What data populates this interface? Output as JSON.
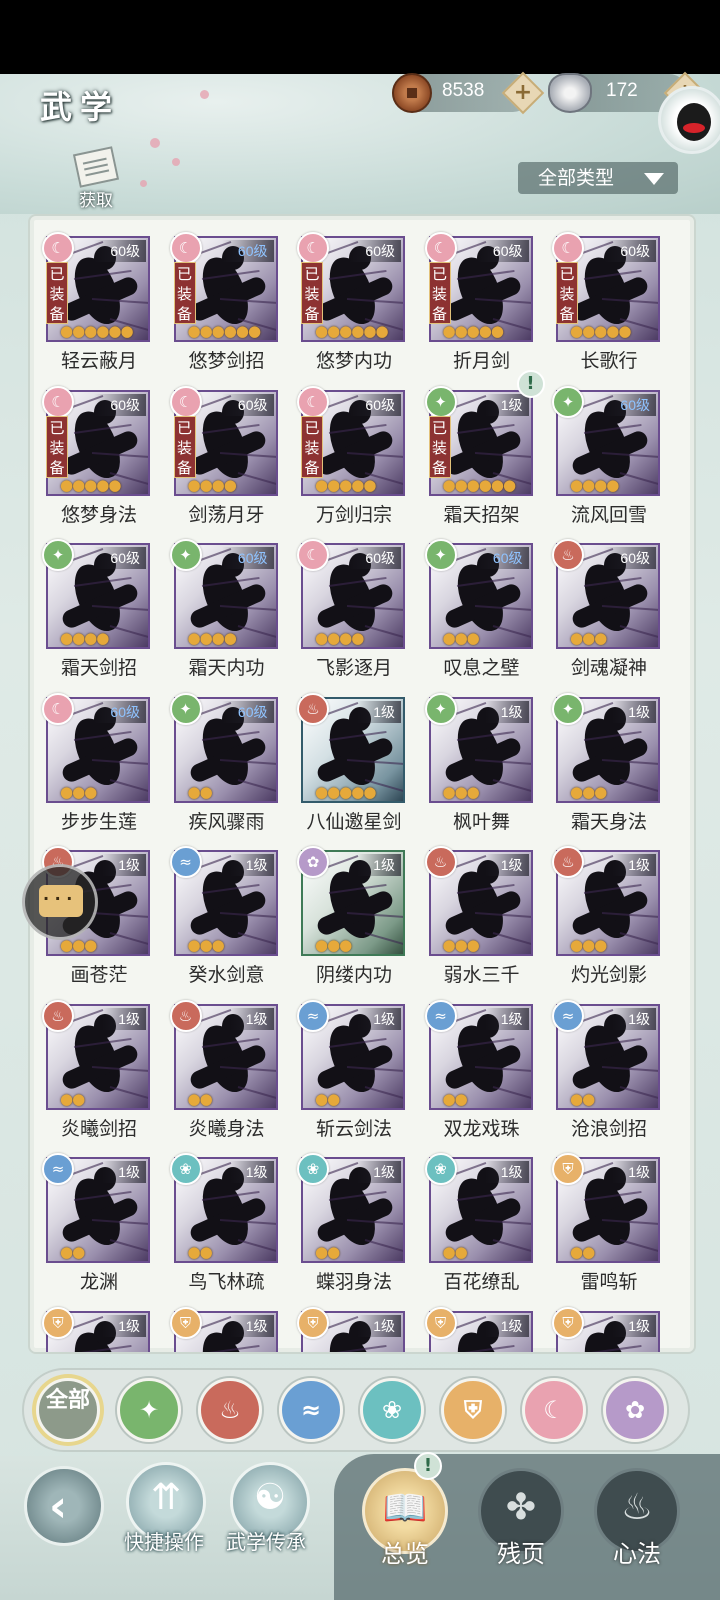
{
  "header": {
    "title": "武学",
    "copper": "8538",
    "silver": "172",
    "acquire_label": "获取",
    "filter_label": "全部类型"
  },
  "skills": [
    {
      "name": "轻云蔽月",
      "level": "60级",
      "element": "pink",
      "equipped": true,
      "stars": 6
    },
    {
      "name": "悠梦剑招",
      "level": "60级",
      "element": "pink",
      "equipped": true,
      "stars": 6,
      "level_blue": true
    },
    {
      "name": "悠梦内功",
      "level": "60级",
      "element": "pink",
      "equipped": true,
      "stars": 6
    },
    {
      "name": "折月剑",
      "level": "60级",
      "element": "pink",
      "equipped": true,
      "stars": 5
    },
    {
      "name": "长歌行",
      "level": "60级",
      "element": "pink",
      "equipped": true,
      "stars": 5
    },
    {
      "name": "悠梦身法",
      "level": "60级",
      "element": "pink",
      "equipped": true,
      "stars": 5
    },
    {
      "name": "剑荡月牙",
      "level": "60级",
      "element": "pink",
      "equipped": true,
      "stars": 4
    },
    {
      "name": "万剑归宗",
      "level": "60级",
      "element": "pink",
      "equipped": true,
      "stars": 5
    },
    {
      "name": "霜天招架",
      "level": "1级",
      "element": "green",
      "equipped": true,
      "stars": 6,
      "alert": true
    },
    {
      "name": "流风回雪",
      "level": "60级",
      "element": "green",
      "equipped": false,
      "stars": 4,
      "level_blue": true
    },
    {
      "name": "霜天剑招",
      "level": "60级",
      "element": "green",
      "equipped": false,
      "stars": 4
    },
    {
      "name": "霜天内功",
      "level": "60级",
      "element": "green",
      "equipped": false,
      "stars": 4,
      "level_blue": true
    },
    {
      "name": "飞影逐月",
      "level": "60级",
      "element": "pink",
      "equipped": false,
      "stars": 4
    },
    {
      "name": "叹息之壁",
      "level": "60级",
      "element": "green",
      "equipped": false,
      "stars": 3,
      "level_blue": true
    },
    {
      "name": "剑魂凝神",
      "level": "60级",
      "element": "red",
      "equipped": false,
      "stars": 3
    },
    {
      "name": "步步生莲",
      "level": "60级",
      "element": "pink",
      "equipped": false,
      "stars": 3,
      "level_blue": true
    },
    {
      "name": "疾风骤雨",
      "level": "60级",
      "element": "green",
      "equipped": false,
      "stars": 2,
      "level_blue": true
    },
    {
      "name": "八仙邀星剑",
      "level": "1级",
      "element": "red",
      "equipped": false,
      "stars": 5,
      "frame": "teal"
    },
    {
      "name": "枫叶舞",
      "level": "1级",
      "element": "green",
      "equipped": false,
      "stars": 3
    },
    {
      "name": "霜天身法",
      "level": "1级",
      "element": "green",
      "equipped": false,
      "stars": 3
    },
    {
      "name": "画苍茫",
      "level": "1级",
      "element": "red",
      "equipped": false,
      "stars": 3
    },
    {
      "name": "癸水剑意",
      "level": "1级",
      "element": "blue",
      "equipped": false,
      "stars": 3
    },
    {
      "name": "阴缕内功",
      "level": "1级",
      "element": "purple",
      "equipped": false,
      "stars": 3,
      "frame": "green"
    },
    {
      "name": "弱水三千",
      "level": "1级",
      "element": "red",
      "equipped": false,
      "stars": 3
    },
    {
      "name": "灼光剑影",
      "level": "1级",
      "element": "red",
      "equipped": false,
      "stars": 3
    },
    {
      "name": "炎曦剑招",
      "level": "1级",
      "element": "red",
      "equipped": false,
      "stars": 2
    },
    {
      "name": "炎曦身法",
      "level": "1级",
      "element": "red",
      "equipped": false,
      "stars": 2
    },
    {
      "name": "斩云剑法",
      "level": "1级",
      "element": "blue",
      "equipped": false,
      "stars": 2
    },
    {
      "name": "双龙戏珠",
      "level": "1级",
      "element": "blue",
      "equipped": false,
      "stars": 2
    },
    {
      "name": "沧浪剑招",
      "level": "1级",
      "element": "blue",
      "equipped": false,
      "stars": 2
    },
    {
      "name": "龙渊",
      "level": "1级",
      "element": "blue",
      "equipped": false,
      "stars": 2
    },
    {
      "name": "鸟飞林疏",
      "level": "1级",
      "element": "cyan",
      "equipped": false,
      "stars": 2
    },
    {
      "name": "蝶羽身法",
      "level": "1级",
      "element": "cyan",
      "equipped": false,
      "stars": 2
    },
    {
      "name": "百花缭乱",
      "level": "1级",
      "element": "cyan",
      "equipped": false,
      "stars": 2
    },
    {
      "name": "雷鸣斩",
      "level": "1级",
      "element": "gold",
      "equipped": false,
      "stars": 2
    },
    {
      "name": "",
      "level": "1级",
      "element": "gold",
      "equipped": false,
      "stars": 0
    },
    {
      "name": "",
      "level": "1级",
      "element": "gold",
      "equipped": false,
      "stars": 0
    },
    {
      "name": "",
      "level": "1级",
      "element": "gold",
      "equipped": false,
      "stars": 0
    },
    {
      "name": "",
      "level": "1级",
      "element": "gold",
      "equipped": false,
      "stars": 0
    },
    {
      "name": "",
      "level": "1级",
      "element": "gold",
      "equipped": false,
      "stars": 0
    }
  ],
  "equipped_label": "已装备",
  "element_filters": [
    {
      "key": "all",
      "label": "全部",
      "color": "#8d9a8a"
    },
    {
      "key": "wind",
      "icon": "wind-icon",
      "color": "#79b56d"
    },
    {
      "key": "fire",
      "icon": "flame-icon",
      "color": "#c96a5c"
    },
    {
      "key": "water",
      "icon": "wave-icon",
      "color": "#6a9fd3"
    },
    {
      "key": "butterfly",
      "icon": "butterfly-icon",
      "color": "#6cc0c0"
    },
    {
      "key": "shield",
      "icon": "shield-icon",
      "color": "#e7b169"
    },
    {
      "key": "moon",
      "icon": "moon-icon",
      "color": "#e9a2b0"
    },
    {
      "key": "rose",
      "icon": "rose-icon",
      "color": "#b69ac9"
    }
  ],
  "bottom": {
    "quick_ops": "快捷操作",
    "inherit": "武学传承",
    "tabs": [
      "总览",
      "残页",
      "心法"
    ]
  }
}
